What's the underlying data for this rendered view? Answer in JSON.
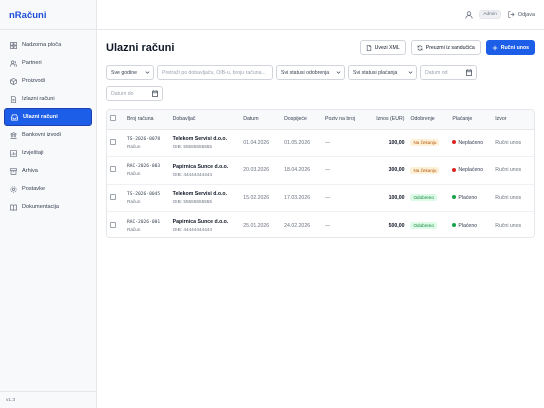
{
  "app": {
    "name": "nRačuni",
    "version": "v1.3"
  },
  "sidebar": {
    "items": [
      {
        "label": "Nadzorna ploča",
        "icon": "dashboard-icon"
      },
      {
        "label": "Partneri",
        "icon": "partners-icon"
      },
      {
        "label": "Proizvodi",
        "icon": "products-icon"
      },
      {
        "label": "Izlazni računi",
        "icon": "outgoing-invoice-icon"
      },
      {
        "label": "Ulazni računi",
        "icon": "incoming-invoice-icon",
        "active": true
      },
      {
        "label": "Bankovni izvodi",
        "icon": "bank-icon"
      },
      {
        "label": "Izvještaji",
        "icon": "reports-icon"
      },
      {
        "label": "Arhiva",
        "icon": "archive-icon"
      },
      {
        "label": "Postavke",
        "icon": "settings-icon"
      },
      {
        "label": "Dokumentacija",
        "icon": "docs-icon"
      }
    ]
  },
  "topbar": {
    "user_badge": "Admin",
    "logout_label": "Odjava"
  },
  "page": {
    "title": "Ulazni računi",
    "buttons": {
      "import_xml": "Uvezi XML",
      "fetch_exchange": "Preuzmi iz sandučića",
      "manual_entry": "Ručni unos"
    }
  },
  "filters": {
    "year": "Sve godine",
    "search_placeholder": "Pretraži po dobavljaču, OIB-u, broju računa...",
    "approval_status": "Svi statusi odobrenja",
    "payment_status": "Svi statusi plaćanja",
    "date_from_placeholder": "Datum od",
    "date_to_placeholder": "Datum do"
  },
  "table": {
    "columns": [
      "Broj računa",
      "Dobavljač",
      "Datum",
      "Dospijeće",
      "Poziv na broj",
      "Iznos (EUR)",
      "Odobrenje",
      "Plaćanje",
      "Izvor"
    ],
    "rows": [
      {
        "number": "TS-2026-0078",
        "doc_type": "Račun",
        "supplier": "Telekom Servisi d.o.o.",
        "oib": "OIB: 55555555555",
        "date": "01.04.2026",
        "due": "01.05.2026",
        "reference": "—",
        "amount": "100,00",
        "approval": "Na čekanju",
        "approval_state": "pending",
        "payment": "Neplaćeno",
        "payment_color": "#dc2626",
        "source": "Ručni unos"
      },
      {
        "number": "RAC-2026-003",
        "doc_type": "Račun",
        "supplier": "Papirnica Sunce d.o.o.",
        "oib": "OIB: 44444444444",
        "date": "20.03.2026",
        "due": "18.04.2026",
        "reference": "—",
        "amount": "300,00",
        "approval": "Na čekanju",
        "approval_state": "pending",
        "payment": "Neplaćeno",
        "payment_color": "#dc2626",
        "source": "Ručni unos"
      },
      {
        "number": "TS-2026-0045",
        "doc_type": "Račun",
        "supplier": "Telekom Servisi d.o.o.",
        "oib": "OIB: 55555555555",
        "date": "15.02.2026",
        "due": "17.03.2026",
        "reference": "—",
        "amount": "100,00",
        "approval": "Odobreno",
        "approval_state": "approved",
        "payment": "Plaćeno",
        "payment_color": "#16a34a",
        "source": "Ručni unos"
      },
      {
        "number": "RAC-2026-001",
        "doc_type": "Račun",
        "supplier": "Papirnica Sunce d.o.o.",
        "oib": "OIB: 44444444444",
        "date": "25.01.2026",
        "due": "24.02.2026",
        "reference": "—",
        "amount": "500,00",
        "approval": "Odobreno",
        "approval_state": "approved",
        "payment": "Plaćeno",
        "payment_color": "#16a34a",
        "source": "Ručni unos"
      }
    ]
  },
  "colors": {
    "accent": "#1d5ee8",
    "brand": "#1d4ed8",
    "pending_bg": "#fdf2d8",
    "approved_bg": "#dcfce7"
  }
}
